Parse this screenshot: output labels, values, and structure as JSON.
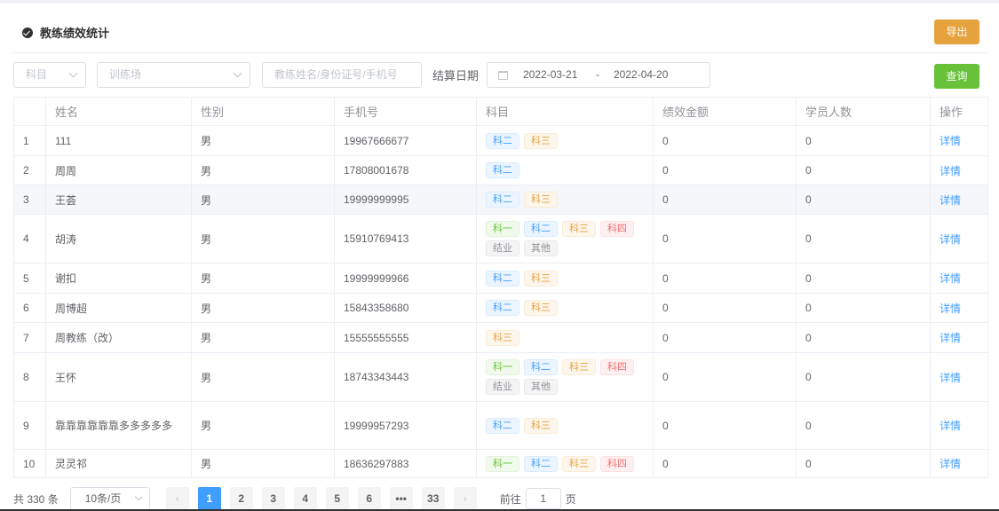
{
  "header": {
    "title": "教练绩效统计",
    "export_label": "导出"
  },
  "filters": {
    "subject_placeholder": "科目",
    "field_placeholder": "训练场",
    "search_placeholder": "教练姓名/身份证号/手机号",
    "date_label": "结算日期",
    "date_start": "2022-03-21",
    "date_sep": "-",
    "date_end": "2022-04-20",
    "query_label": "查询"
  },
  "table": {
    "headers": {
      "name": "姓名",
      "sex": "性别",
      "phone": "手机号",
      "subject": "科目",
      "amount": "绩效金额",
      "students": "学员人数",
      "op": "操作"
    },
    "detail_label": "详情",
    "rows": [
      {
        "idx": "1",
        "name": "111",
        "sex": "男",
        "phone": "19967666677",
        "subjects": [
          "科二",
          "科三"
        ],
        "amount": "0",
        "students": "0"
      },
      {
        "idx": "2",
        "name": "周周",
        "sex": "男",
        "phone": "17808001678",
        "subjects": [
          "科二"
        ],
        "amount": "0",
        "students": "0"
      },
      {
        "idx": "3",
        "name": "王荟",
        "sex": "男",
        "phone": "19999999995",
        "subjects": [
          "科二",
          "科三"
        ],
        "amount": "0",
        "students": "0"
      },
      {
        "idx": "4",
        "name": "胡涛",
        "sex": "男",
        "phone": "15910769413",
        "subjects": [
          "科一",
          "科二",
          "科三",
          "科四",
          "结业",
          "其他"
        ],
        "amount": "0",
        "students": "0"
      },
      {
        "idx": "5",
        "name": "谢扣",
        "sex": "男",
        "phone": "19999999966",
        "subjects": [
          "科二",
          "科三"
        ],
        "amount": "0",
        "students": "0"
      },
      {
        "idx": "6",
        "name": "周博超",
        "sex": "男",
        "phone": "15843358680",
        "subjects": [
          "科二",
          "科三"
        ],
        "amount": "0",
        "students": "0"
      },
      {
        "idx": "7",
        "name": "周教练（改）",
        "sex": "男",
        "phone": "15555555555",
        "subjects": [
          "科三"
        ],
        "amount": "0",
        "students": "0"
      },
      {
        "idx": "8",
        "name": "王怀",
        "sex": "男",
        "phone": "18743343443",
        "subjects": [
          "科一",
          "科二",
          "科三",
          "科四",
          "结业",
          "其他"
        ],
        "amount": "0",
        "students": "0"
      },
      {
        "idx": "9",
        "name": "靠靠靠靠靠靠多多多多多",
        "sex": "男",
        "phone": "19999957293",
        "subjects": [
          "科二",
          "科三"
        ],
        "amount": "0",
        "students": "0"
      },
      {
        "idx": "10",
        "name": "灵灵祁",
        "sex": "男",
        "phone": "18636297883",
        "subjects": [
          "科一",
          "科二",
          "科三",
          "科四"
        ],
        "amount": "0",
        "students": "0"
      }
    ]
  },
  "tag_colors": {
    "科一": "green",
    "科二": "blue",
    "科三": "orange",
    "科四": "red",
    "结业": "gray",
    "其他": "gray"
  },
  "pagination": {
    "total": "共 330 条",
    "page_size": "10条/页",
    "pages": [
      "1",
      "2",
      "3",
      "4",
      "5",
      "6",
      "•••",
      "33"
    ],
    "current": "1",
    "prev": "‹",
    "next": "›",
    "goto_label": "前往",
    "goto_value": "1",
    "goto_suffix": "页"
  }
}
